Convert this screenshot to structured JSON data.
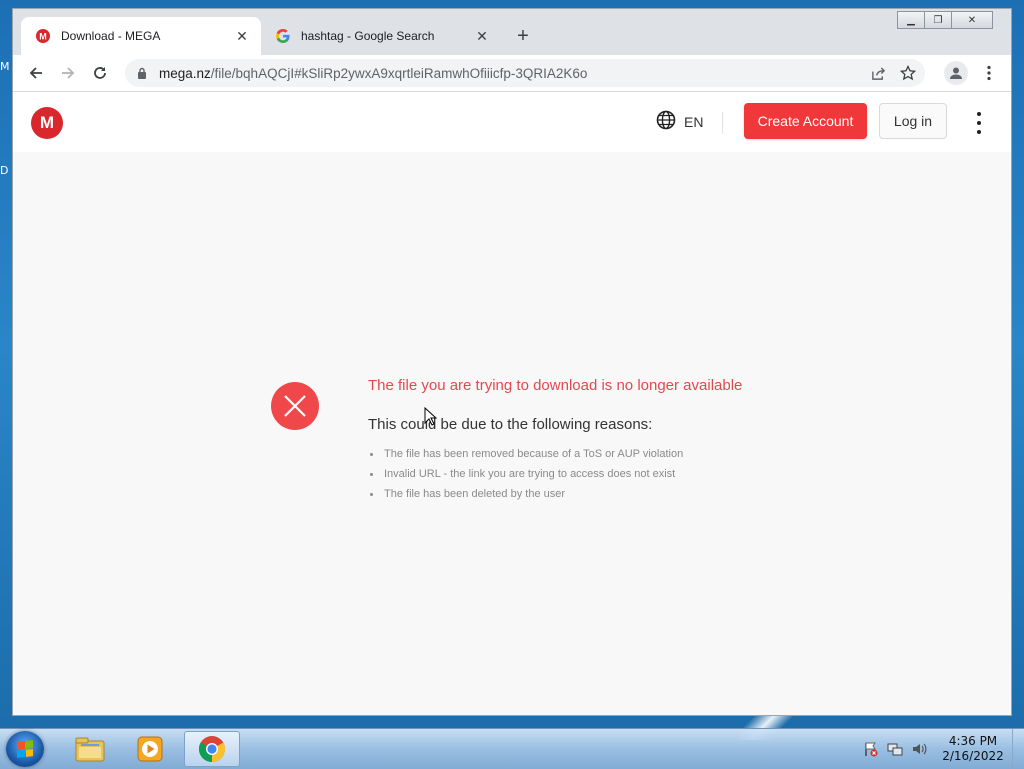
{
  "desktop": {
    "edge_labels": [
      "M",
      "D"
    ]
  },
  "browser": {
    "tabs": [
      {
        "title": "Download - MEGA",
        "favicon": "mega-icon",
        "active": true
      },
      {
        "title": "hashtag - Google Search",
        "favicon": "google-icon",
        "active": false
      }
    ],
    "address": {
      "host": "mega.nz",
      "path": "/file/bqhAQCjI#kSliRp2ywxA9xqrtleiRamwhOfiiicfp-3QRIA2K6o"
    }
  },
  "mega": {
    "logo_letter": "M",
    "language": "EN",
    "create_account": "Create Account",
    "login": "Log in",
    "error": {
      "title": "The file you are trying to download is no longer available",
      "subtitle": "This could be due to the following reasons:",
      "reasons": [
        "The file has been removed because of a ToS or AUP violation",
        "Invalid URL - the link you are trying to access does not exist",
        "The file has been deleted by the user"
      ]
    },
    "colors": {
      "brand_red": "#d9272e",
      "button_red": "#f0373a",
      "error_text": "#e04a4f"
    }
  },
  "taskbar": {
    "items": [
      "file-explorer-icon",
      "media-player-icon",
      "chrome-icon"
    ],
    "clock": {
      "time": "4:36 PM",
      "date": "2/16/2022"
    }
  }
}
